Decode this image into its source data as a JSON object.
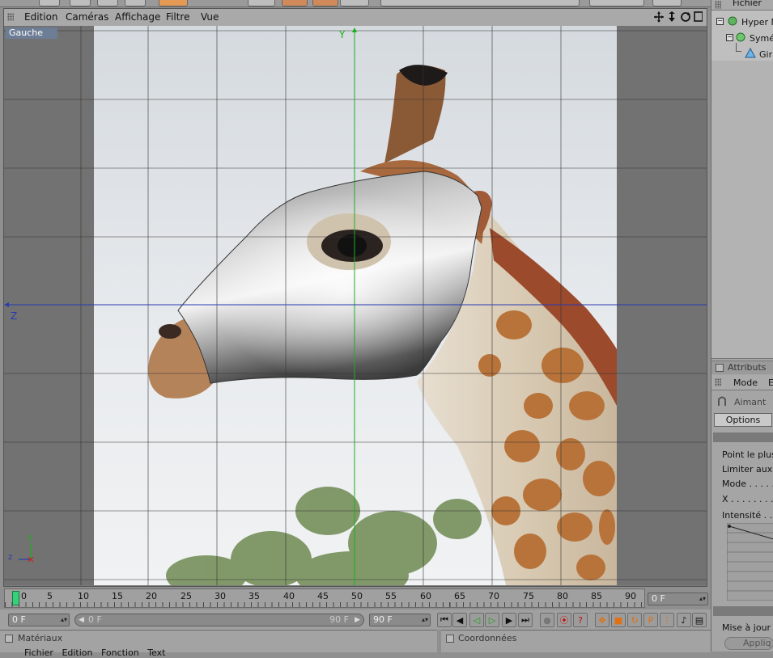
{
  "menu": {
    "items": [
      "Edition",
      "Caméras",
      "Affichage",
      "Filtre",
      "Vue"
    ]
  },
  "viewport": {
    "label": "Gauche",
    "axis_y_label": "Y",
    "axis_z_label": "Z",
    "gizmo_y": "y",
    "gizmo_z": "z",
    "nav_icons": [
      "move-icon",
      "down-arrow-icon",
      "rotate-icon",
      "maximize-icon"
    ]
  },
  "object_manager": {
    "header": "Fichier",
    "items": [
      "Hyper N",
      "Symét",
      "Gira"
    ]
  },
  "attributes": {
    "title": "Attributs",
    "mode_label": "Mode",
    "mode_extra": "E",
    "tool_name": "Aimant",
    "options_tab": "Options",
    "fields": [
      "Point le plus",
      "Limiter aux",
      "Mode . . . . . .",
      "X . . . . . . . .",
      "Intensité . . ."
    ],
    "update_label": "Mise à jour",
    "apply_button": "Appliq"
  },
  "timeline": {
    "ticks": [
      "0",
      "5",
      "10",
      "15",
      "20",
      "25",
      "30",
      "35",
      "40",
      "45",
      "50",
      "55",
      "60",
      "65",
      "70",
      "75",
      "80",
      "85",
      "90"
    ],
    "current_frame_display": "0 F"
  },
  "transport": {
    "start_field": "0 F",
    "range_start": "0 F",
    "range_end": "90 F",
    "end_field": "90 F"
  },
  "bottom": {
    "materials_title": "Matériaux",
    "materials_menu": "Fichier   Edition   Fonction   Text",
    "coords_title": "Coordonnées"
  },
  "colors": {
    "accent_blue": "#2a3ab0",
    "axis_green": "#19b019",
    "view_label_bg": "#6d7d95"
  }
}
